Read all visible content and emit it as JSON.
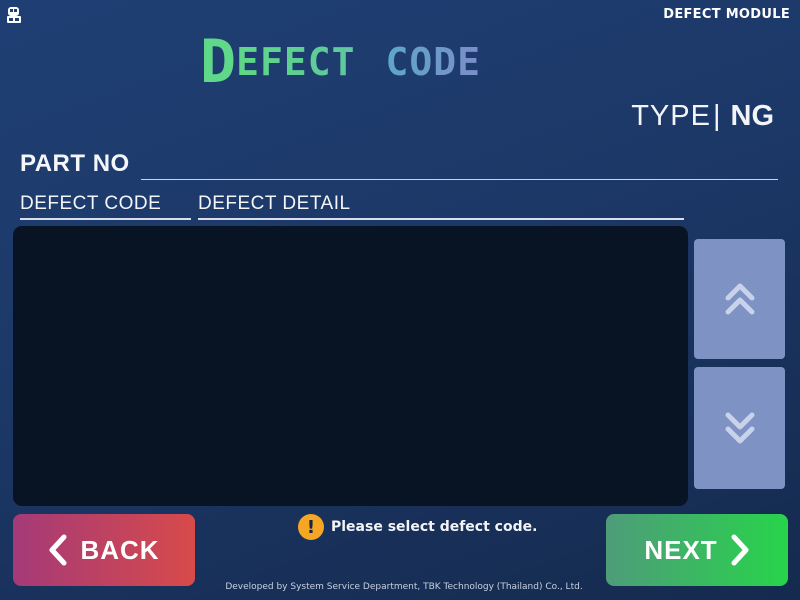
{
  "header": {
    "module_label": "DEFECT MODULE",
    "title_initial": "D",
    "title_rest": "EFECT",
    "title_second": "CODE"
  },
  "type_row": {
    "label": "TYPE",
    "divider": "|",
    "value": "NG"
  },
  "form": {
    "part_no_label": "PART NO",
    "part_no_value": ""
  },
  "table": {
    "columns": [
      "DEFECT CODE",
      "DEFECT DETAIL"
    ],
    "rows": []
  },
  "controls": {
    "back_label": "BACK",
    "next_label": "NEXT",
    "notice": "Please select defect code."
  },
  "footer": {
    "credit": "Developed by System Service Department, TBK Technology (Thailand) Co., Ltd."
  },
  "colors": {
    "back_start": "#a43a78",
    "back_end": "#d84a4a",
    "next_start": "#4e9c7a",
    "next_end": "#27d44a",
    "scroll_button": "#7e92c3",
    "warning": "#f5a623",
    "title_green": "#5fd88a",
    "title_blue": "#6f95c8"
  },
  "icons": {
    "app": "app-icon",
    "scroll_up": "double-chevron-up-icon",
    "scroll_down": "double-chevron-down-icon",
    "back": "chevron-left-icon",
    "next": "chevron-right-icon",
    "notice": "warning-icon"
  }
}
